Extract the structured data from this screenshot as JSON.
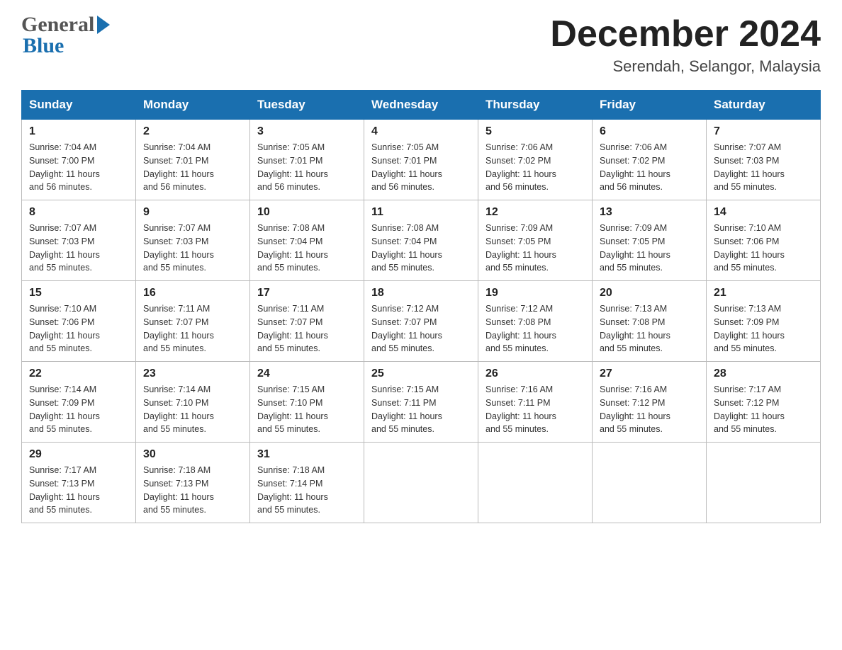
{
  "header": {
    "title": "December 2024",
    "location": "Serendah, Selangor, Malaysia",
    "logo_general": "General",
    "logo_blue": "Blue"
  },
  "calendar": {
    "days_of_week": [
      "Sunday",
      "Monday",
      "Tuesday",
      "Wednesday",
      "Thursday",
      "Friday",
      "Saturday"
    ],
    "weeks": [
      [
        {
          "day": "1",
          "sunrise": "7:04 AM",
          "sunset": "7:00 PM",
          "daylight": "11 hours and 56 minutes."
        },
        {
          "day": "2",
          "sunrise": "7:04 AM",
          "sunset": "7:01 PM",
          "daylight": "11 hours and 56 minutes."
        },
        {
          "day": "3",
          "sunrise": "7:05 AM",
          "sunset": "7:01 PM",
          "daylight": "11 hours and 56 minutes."
        },
        {
          "day": "4",
          "sunrise": "7:05 AM",
          "sunset": "7:01 PM",
          "daylight": "11 hours and 56 minutes."
        },
        {
          "day": "5",
          "sunrise": "7:06 AM",
          "sunset": "7:02 PM",
          "daylight": "11 hours and 56 minutes."
        },
        {
          "day": "6",
          "sunrise": "7:06 AM",
          "sunset": "7:02 PM",
          "daylight": "11 hours and 56 minutes."
        },
        {
          "day": "7",
          "sunrise": "7:07 AM",
          "sunset": "7:03 PM",
          "daylight": "11 hours and 55 minutes."
        }
      ],
      [
        {
          "day": "8",
          "sunrise": "7:07 AM",
          "sunset": "7:03 PM",
          "daylight": "11 hours and 55 minutes."
        },
        {
          "day": "9",
          "sunrise": "7:07 AM",
          "sunset": "7:03 PM",
          "daylight": "11 hours and 55 minutes."
        },
        {
          "day": "10",
          "sunrise": "7:08 AM",
          "sunset": "7:04 PM",
          "daylight": "11 hours and 55 minutes."
        },
        {
          "day": "11",
          "sunrise": "7:08 AM",
          "sunset": "7:04 PM",
          "daylight": "11 hours and 55 minutes."
        },
        {
          "day": "12",
          "sunrise": "7:09 AM",
          "sunset": "7:05 PM",
          "daylight": "11 hours and 55 minutes."
        },
        {
          "day": "13",
          "sunrise": "7:09 AM",
          "sunset": "7:05 PM",
          "daylight": "11 hours and 55 minutes."
        },
        {
          "day": "14",
          "sunrise": "7:10 AM",
          "sunset": "7:06 PM",
          "daylight": "11 hours and 55 minutes."
        }
      ],
      [
        {
          "day": "15",
          "sunrise": "7:10 AM",
          "sunset": "7:06 PM",
          "daylight": "11 hours and 55 minutes."
        },
        {
          "day": "16",
          "sunrise": "7:11 AM",
          "sunset": "7:07 PM",
          "daylight": "11 hours and 55 minutes."
        },
        {
          "day": "17",
          "sunrise": "7:11 AM",
          "sunset": "7:07 PM",
          "daylight": "11 hours and 55 minutes."
        },
        {
          "day": "18",
          "sunrise": "7:12 AM",
          "sunset": "7:07 PM",
          "daylight": "11 hours and 55 minutes."
        },
        {
          "day": "19",
          "sunrise": "7:12 AM",
          "sunset": "7:08 PM",
          "daylight": "11 hours and 55 minutes."
        },
        {
          "day": "20",
          "sunrise": "7:13 AM",
          "sunset": "7:08 PM",
          "daylight": "11 hours and 55 minutes."
        },
        {
          "day": "21",
          "sunrise": "7:13 AM",
          "sunset": "7:09 PM",
          "daylight": "11 hours and 55 minutes."
        }
      ],
      [
        {
          "day": "22",
          "sunrise": "7:14 AM",
          "sunset": "7:09 PM",
          "daylight": "11 hours and 55 minutes."
        },
        {
          "day": "23",
          "sunrise": "7:14 AM",
          "sunset": "7:10 PM",
          "daylight": "11 hours and 55 minutes."
        },
        {
          "day": "24",
          "sunrise": "7:15 AM",
          "sunset": "7:10 PM",
          "daylight": "11 hours and 55 minutes."
        },
        {
          "day": "25",
          "sunrise": "7:15 AM",
          "sunset": "7:11 PM",
          "daylight": "11 hours and 55 minutes."
        },
        {
          "day": "26",
          "sunrise": "7:16 AM",
          "sunset": "7:11 PM",
          "daylight": "11 hours and 55 minutes."
        },
        {
          "day": "27",
          "sunrise": "7:16 AM",
          "sunset": "7:12 PM",
          "daylight": "11 hours and 55 minutes."
        },
        {
          "day": "28",
          "sunrise": "7:17 AM",
          "sunset": "7:12 PM",
          "daylight": "11 hours and 55 minutes."
        }
      ],
      [
        {
          "day": "29",
          "sunrise": "7:17 AM",
          "sunset": "7:13 PM",
          "daylight": "11 hours and 55 minutes."
        },
        {
          "day": "30",
          "sunrise": "7:18 AM",
          "sunset": "7:13 PM",
          "daylight": "11 hours and 55 minutes."
        },
        {
          "day": "31",
          "sunrise": "7:18 AM",
          "sunset": "7:14 PM",
          "daylight": "11 hours and 55 minutes."
        },
        null,
        null,
        null,
        null
      ]
    ],
    "sunrise_label": "Sunrise:",
    "sunset_label": "Sunset:",
    "daylight_label": "Daylight:"
  }
}
